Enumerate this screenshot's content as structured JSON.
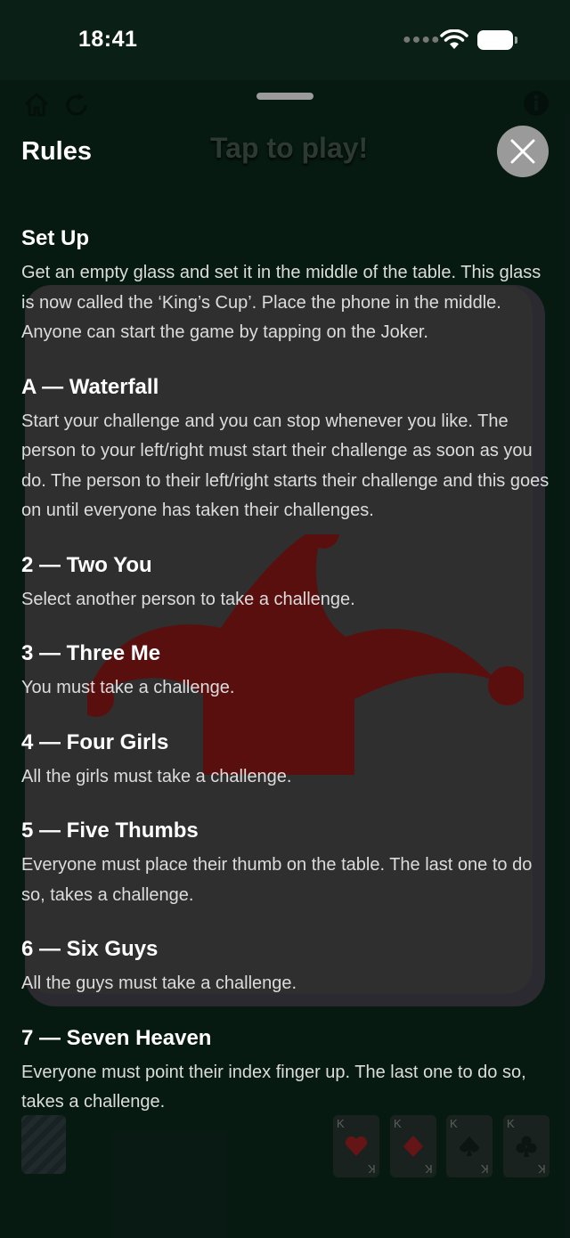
{
  "status": {
    "time": "18:41"
  },
  "game": {
    "tap_to_play": "Tap to play!"
  },
  "sheet": {
    "title": "Rules"
  },
  "mini_cards": [
    {
      "rank": "K",
      "suit": "hearts",
      "color": "#b3121b"
    },
    {
      "rank": "K",
      "suit": "diamonds",
      "color": "#b3121b"
    },
    {
      "rank": "K",
      "suit": "spades",
      "color": "#111111"
    },
    {
      "rank": "K",
      "suit": "clubs",
      "color": "#111111"
    }
  ],
  "colors": {
    "background": "#061610",
    "joker": "#5a0f0f",
    "close": "#9a9a9a"
  },
  "rules": [
    {
      "title": "Set Up",
      "body": "Get an empty glass and set it in the middle of the table. This glass is now called the ‘King’s Cup’. Place the phone in the middle. Anyone can start the game by tapping on the Joker."
    },
    {
      "title": "A — Waterfall",
      "body": "Start your challenge and you can stop whenever you like. The person to your left/right must start their challenge as soon as you do. The person to their left/right starts their challenge and this goes on until everyone has taken their challenges."
    },
    {
      "title": "2 — Two You",
      "body": "Select another person to take a challenge."
    },
    {
      "title": "3 — Three Me",
      "body": "You must take a challenge."
    },
    {
      "title": "4 — Four Girls",
      "body": "All the girls must take a challenge."
    },
    {
      "title": "5 — Five Thumbs",
      "body": "Everyone must place their thumb on the table. The last one to do so, takes a challenge."
    },
    {
      "title": "6 — Six Guys",
      "body": "All the guys must take a challenge."
    },
    {
      "title": "7 — Seven Heaven",
      "body": "Everyone must point their index finger up. The last one to do so, takes a challenge."
    }
  ]
}
